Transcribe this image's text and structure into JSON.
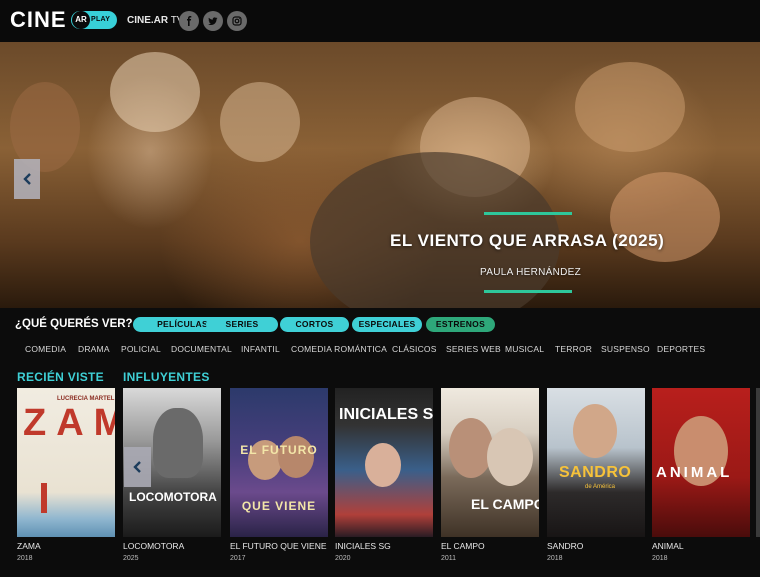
{
  "header": {
    "logo_text": "CINE",
    "logo_badge_ar": "AR",
    "logo_badge_play": "PLAY",
    "cinear_tv_bold": "CINE.AR",
    "cinear_tv_rest": " TV",
    "social": [
      "facebook-icon",
      "twitter-icon",
      "instagram-icon"
    ]
  },
  "hero": {
    "title": "EL VIENTO QUE ARRASA (2025)",
    "director": "PAULA HERNÁNDEZ",
    "accent": "#2ec79b"
  },
  "filters": {
    "question": "¿QUÉ QUERÉS VER?",
    "pills": [
      "PELÍCULAS",
      "SERIES",
      "CORTOS",
      "ESPECIALES",
      "ESTRENOS"
    ],
    "genres": [
      "COMEDIA",
      "DRAMA",
      "POLICIAL",
      "DOCUMENTAL",
      "INFANTIL",
      "COMEDIA ROMÁNTICA",
      "CLÁSICOS",
      "SERIES WEB",
      "MUSICAL",
      "TERROR",
      "SUSPENSO",
      "DEPORTES"
    ],
    "accent": "#3fd0d6"
  },
  "sections": {
    "recent": "RECIÉN VISTE",
    "influential": "INFLUYENTES"
  },
  "posters": [
    {
      "title": "ZAMA",
      "year": "2018",
      "art_text": "ZAMA",
      "art_sub": "LUCRECIA MARTEL"
    },
    {
      "title": "LOCOMOTORA",
      "year": "2025",
      "art_text": "LOCOMOTORA"
    },
    {
      "title": "EL FUTURO QUE VIENE",
      "year": "2017",
      "art_text": "EL FUTURO QUE VIENE"
    },
    {
      "title": "INICIALES SG",
      "year": "2020",
      "art_text": "INICIALES SG"
    },
    {
      "title": "EL CAMPO",
      "year": "2011",
      "art_text": "EL CAMPO"
    },
    {
      "title": "SANDRO",
      "year": "2018",
      "art_text": "SANDRO",
      "art_sub": "de América"
    },
    {
      "title": "ANIMAL",
      "year": "2018",
      "art_text": "ANIMAL"
    }
  ]
}
